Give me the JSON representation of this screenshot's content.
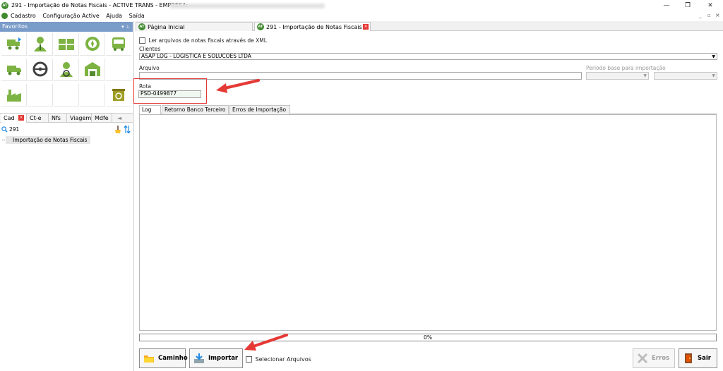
{
  "window": {
    "title": "291 - Importação de Notas Fiscais - ACTIVE TRANS - EMPRESA:",
    "logo_text": "AT",
    "minimize": "—",
    "restore": "❐",
    "close": "✕"
  },
  "menu": {
    "items": [
      "Cadastro",
      "Configuração Active",
      "Ajuda",
      "Saída"
    ],
    "mdi_controls": [
      "_",
      "▫",
      "×"
    ]
  },
  "favorites": {
    "title": "Favoritos",
    "pin": "▾ ⊥",
    "icons": [
      "truck-add-icon",
      "user-icon",
      "fleet-icon",
      "wheel-icon",
      "bus-icon",
      "delivery-truck-icon",
      "steering-wheel-icon",
      "driver-icon",
      "warehouse-icon",
      "factory-icon",
      "recycle-icon"
    ]
  },
  "left_tabs": {
    "items": [
      "Cad",
      "Ct-e",
      "Nfs",
      "Viagem",
      "Mdfe"
    ],
    "scroll": "◄"
  },
  "search": {
    "value": "291"
  },
  "tree": {
    "items": [
      "Importação de Notas Fiscais"
    ]
  },
  "doc_tabs": [
    {
      "label": "Página Inicial"
    },
    {
      "label": "291 - Importação de Notas Fiscais"
    }
  ],
  "form": {
    "xml_checkbox_label": "Ler arquivos de notas fiscais através de XML",
    "clientes_label": "Clientes",
    "clientes_value": "ASAP LOG - LOGISTICA E SOLUCOES LTDA",
    "arquivo_label": "Arquivo",
    "arquivo_value": "",
    "periodo_label": "Periodo base para importação",
    "rota_label": "Rota",
    "rota_value": "PSD-0499877"
  },
  "inner_tabs": [
    "Log",
    "Retorno Banco Terceiro",
    "Erros de Importação"
  ],
  "progress": {
    "text": "0%",
    "value": 0
  },
  "buttons": {
    "caminho": "Caminho",
    "importar": "Importar",
    "selecionar_label": "Selecionar Arquivos",
    "erros": "Erros",
    "sair": "Sair"
  },
  "colors": {
    "accent": "#7a9cc9",
    "brand_green": "#3f8a2e",
    "annotation_red": "#e53935"
  }
}
